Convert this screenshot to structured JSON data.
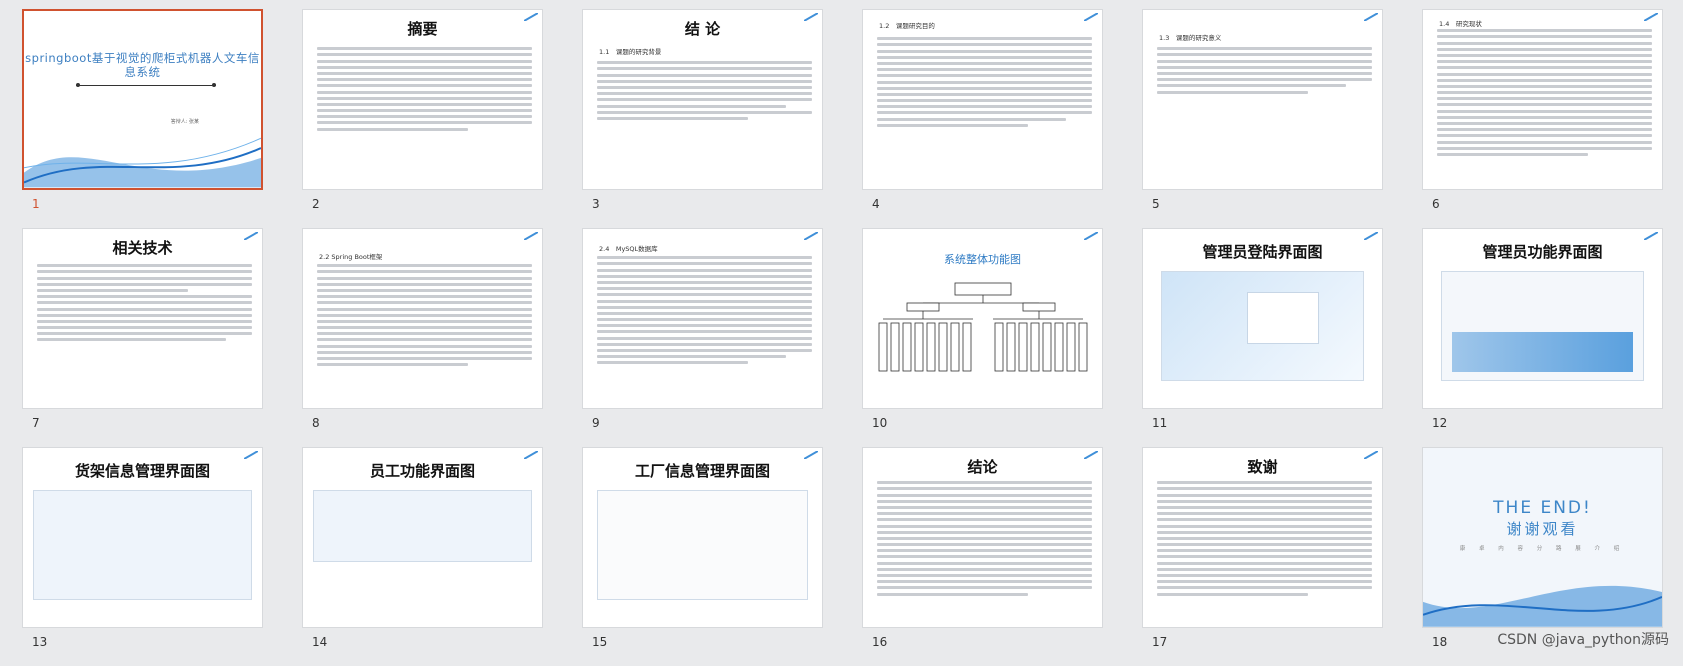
{
  "slides": [
    {
      "num": "1",
      "type": "cover",
      "title": "springboot基于视觉的爬柜式机器人文车信息系统",
      "author": "答辩人: 张某"
    },
    {
      "num": "2",
      "type": "text",
      "title": "摘要"
    },
    {
      "num": "3",
      "type": "text",
      "title": "结 论",
      "heading": "1.1　课题的研究背景"
    },
    {
      "num": "4",
      "type": "text",
      "title": "",
      "heading": "1.2　课题研究目的"
    },
    {
      "num": "5",
      "type": "text",
      "title": "",
      "heading": "1.3　课题的研究意义"
    },
    {
      "num": "6",
      "type": "text",
      "title": "",
      "heading": "1.4　研究现状"
    },
    {
      "num": "7",
      "type": "text",
      "title": "相关技术",
      "heading": ""
    },
    {
      "num": "8",
      "type": "text",
      "title": "",
      "heading": "2.2 Spring Boot框架"
    },
    {
      "num": "9",
      "type": "text",
      "title": "",
      "heading": "2.4　MySQL数据库"
    },
    {
      "num": "10",
      "type": "diagram",
      "title": "系统整体功能图"
    },
    {
      "num": "11",
      "type": "shot",
      "title": "管理员登陆界面图"
    },
    {
      "num": "12",
      "type": "shot",
      "title": "管理员功能界面图"
    },
    {
      "num": "13",
      "type": "shot",
      "title": "货架信息管理界面图"
    },
    {
      "num": "14",
      "type": "shot",
      "title": "员工功能界面图"
    },
    {
      "num": "15",
      "type": "shot",
      "title": "工厂信息管理界面图"
    },
    {
      "num": "16",
      "type": "text",
      "title": "结论"
    },
    {
      "num": "17",
      "type": "text",
      "title": "致谢"
    },
    {
      "num": "18",
      "type": "end",
      "big": "THE END!",
      "sub": "谢谢观看",
      "line": "康 卓 内 容 分 路 展 介 绍"
    }
  ],
  "watermark": "CSDN @java_python源码",
  "colors": {
    "accent": "#d0522f",
    "blue": "#2e7bc4"
  }
}
